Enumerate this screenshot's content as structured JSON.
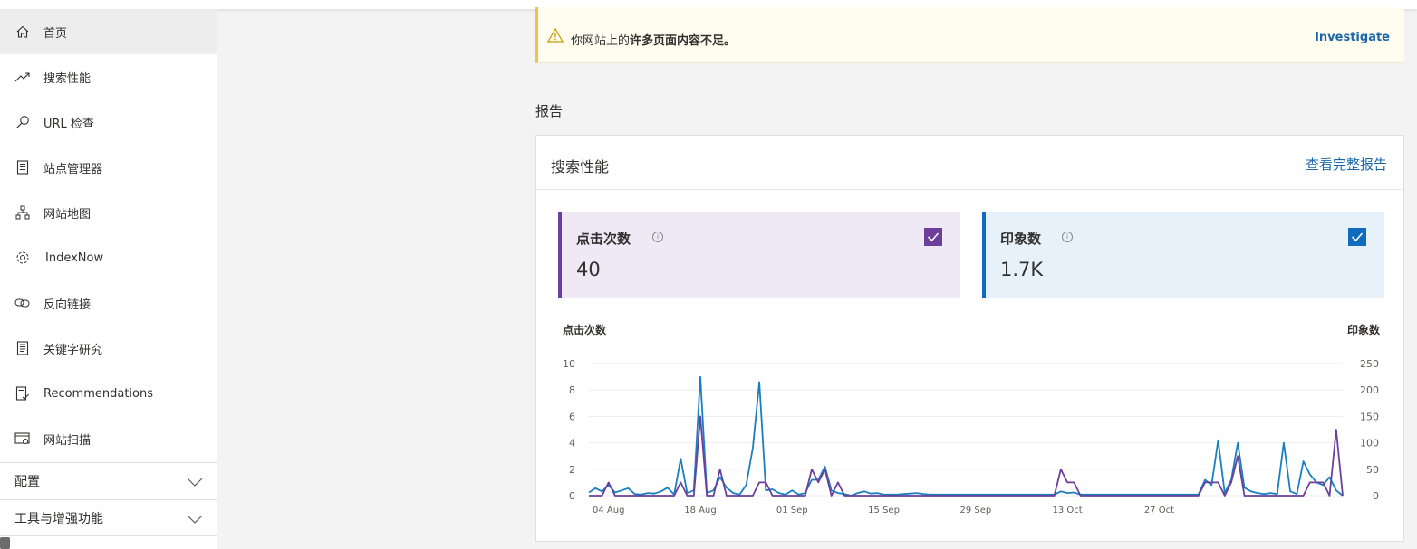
{
  "sidebar": {
    "items": [
      {
        "label": "首页",
        "icon": "home-icon",
        "active": true
      },
      {
        "label": "搜索性能",
        "icon": "trending-icon"
      },
      {
        "label": "URL 检查",
        "icon": "search-icon"
      },
      {
        "label": "站点管理器",
        "icon": "list-document-icon"
      },
      {
        "label": "网站地图",
        "icon": "sitemap-icon"
      },
      {
        "label": "IndexNow",
        "icon": "gear-icon"
      },
      {
        "label": "反向链接",
        "icon": "link-icon"
      },
      {
        "label": "关键字研究",
        "icon": "document-icon"
      },
      {
        "label": "Recommendations",
        "icon": "checklist-icon"
      },
      {
        "label": "网站扫描",
        "icon": "scan-icon"
      }
    ],
    "sections": [
      {
        "label": "配置"
      },
      {
        "label": "工具与增强功能"
      }
    ]
  },
  "banner": {
    "text_prefix": "你网站上的",
    "text_bold": "许多页面内容不足。",
    "link": "Investigate"
  },
  "reports": {
    "title": "报告"
  },
  "performance_card": {
    "title": "搜索性能",
    "link": "查看完整报告",
    "clicks": {
      "label": "点击次数",
      "value": "40",
      "color": "#6c3f9c"
    },
    "impressions": {
      "label": "印象数",
      "value": "1.7K",
      "color": "#0f6cbd"
    },
    "left_axis_title": "点击次数",
    "right_axis_title": "印象数"
  },
  "chart_data": {
    "type": "line",
    "xlabel": "",
    "ylabel": "",
    "x_ticks": [
      "04 Aug",
      "18 Aug",
      "01 Sep",
      "15 Sep",
      "29 Sep",
      "13 Oct",
      "27 Oct"
    ],
    "y_left_ticks": [
      0,
      2,
      4,
      6,
      8,
      10
    ],
    "y_right_ticks": [
      0,
      50,
      100,
      150,
      200,
      250
    ],
    "ylim_left": [
      0,
      10
    ],
    "ylim_right": [
      0,
      250
    ],
    "x_start": "2024-08-01",
    "series": [
      {
        "name": "点击次数",
        "axis": "left",
        "color": "#6c3f9c",
        "values": [
          0,
          0,
          0,
          1,
          0,
          0,
          0,
          0,
          0,
          0,
          0,
          0,
          0,
          0,
          1,
          0,
          0,
          6,
          0,
          0,
          2,
          0,
          0,
          0,
          0,
          0,
          1,
          1,
          0,
          0,
          0,
          0,
          0,
          0,
          2,
          1,
          2,
          0,
          1,
          0,
          0,
          0,
          0,
          0,
          0,
          0,
          0,
          0,
          0,
          0,
          0,
          0,
          0,
          0,
          0,
          0,
          0,
          0,
          0,
          0,
          0,
          0,
          0,
          0,
          0,
          0,
          0,
          0,
          0,
          0,
          0,
          0,
          2,
          1,
          1,
          0,
          0,
          0,
          0,
          0,
          0,
          0,
          0,
          0,
          0,
          0,
          0,
          0,
          0,
          0,
          0,
          0,
          0,
          0,
          1,
          1,
          1,
          0,
          1,
          3,
          0,
          0,
          0,
          0,
          0,
          0,
          0,
          0,
          0,
          0,
          1,
          1,
          1,
          0,
          5,
          0
        ]
      },
      {
        "name": "印象数",
        "axis": "right",
        "color": "#1a7fc1",
        "values": [
          6,
          14,
          8,
          20,
          6,
          10,
          14,
          3,
          2,
          5,
          4,
          8,
          15,
          2,
          70,
          5,
          10,
          225,
          5,
          10,
          35,
          15,
          5,
          2,
          20,
          90,
          215,
          10,
          12,
          5,
          2,
          10,
          2,
          5,
          30,
          30,
          55,
          10,
          5,
          3,
          0,
          5,
          8,
          4,
          5,
          2,
          2,
          2,
          3,
          4,
          5,
          3,
          2,
          2,
          2,
          2,
          2,
          2,
          2,
          2,
          2,
          2,
          2,
          2,
          2,
          2,
          2,
          2,
          2,
          2,
          2,
          2,
          8,
          5,
          6,
          2,
          2,
          2,
          2,
          2,
          2,
          2,
          2,
          2,
          2,
          2,
          2,
          2,
          2,
          2,
          2,
          2,
          2,
          2,
          30,
          20,
          105,
          5,
          30,
          100,
          15,
          8,
          5,
          3,
          5,
          3,
          100,
          8,
          3,
          65,
          40,
          25,
          20,
          35,
          10,
          0
        ]
      }
    ]
  }
}
